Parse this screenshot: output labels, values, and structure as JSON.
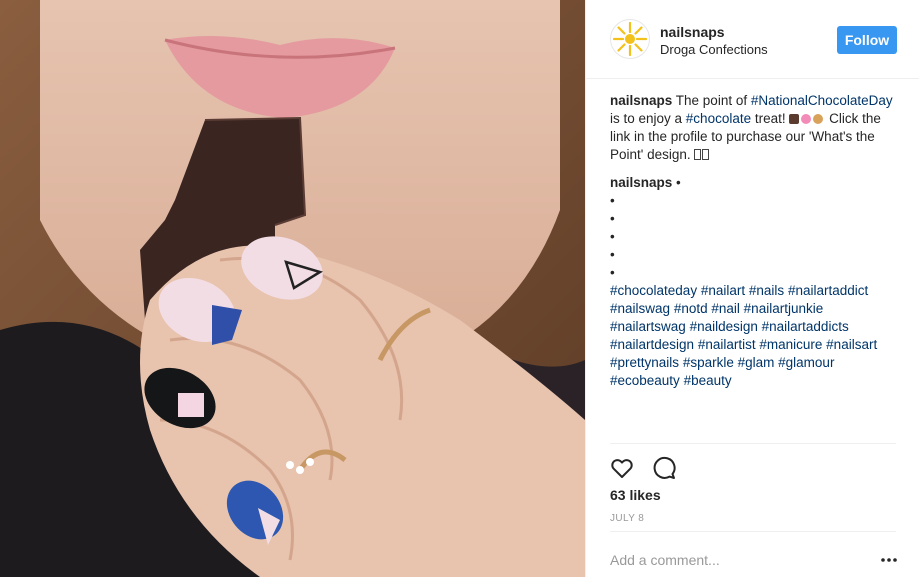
{
  "post": {
    "photo": {
      "subject": "woman-holding-chocolate-with-nail-art"
    },
    "header": {
      "username": "nailsnaps",
      "location": "Droga Confections",
      "follow_label": "Follow",
      "accent_color": "#3897f0"
    },
    "caption": {
      "username": "nailsnaps",
      "text_1": " The point of ",
      "hashtag_1": "#NationalChocolateDay",
      "text_2": " is to enjoy a ",
      "hashtag_2": "#chocolate",
      "text_3": " treat! ",
      "text_4": " Click the link in the profile to purchase our 'What's the Point' design. "
    },
    "tag_comment": {
      "username": "nailsnaps",
      "header_suffix": " •",
      "bullets": [
        "•",
        "•",
        "•",
        "•",
        "•"
      ],
      "hashtags": [
        "#chocolateday",
        "#nailart",
        "#nails",
        "#nailartaddict",
        "#nailswag",
        "#notd",
        "#nail",
        "#nailartjunkie",
        "#nailartswag",
        "#naildesign",
        "#nailartaddicts",
        "#nailartdesign",
        "#nailartist",
        "#manicure",
        "#nailsart",
        "#prettynails",
        "#sparkle",
        "#glam",
        "#glamour",
        "#ecobeauty",
        "#beauty"
      ]
    },
    "icons": {
      "like": "heart-icon",
      "comment": "comment-bubble-icon",
      "more": "more-options-icon",
      "avatar": "sun-logo-icon"
    },
    "likes": "63 likes",
    "date": "JULY 8",
    "add_comment_placeholder": "Add a comment...",
    "hashtag_color": "#003569"
  }
}
